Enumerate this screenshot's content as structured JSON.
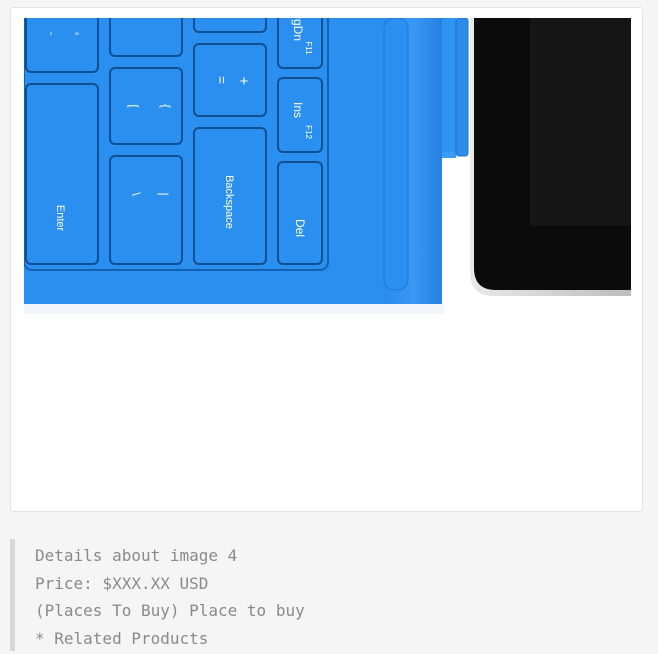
{
  "image": {
    "alt": "",
    "keys": {
      "enter": "Enter",
      "backspace": "Backspace",
      "del": "Del",
      "ins": "Ins",
      "ins_fn": "F12",
      "pgdn": "PgDn",
      "pgdn_fn": "F11",
      "equals": "=",
      "plus": "+",
      "bracket_open": "[",
      "brace_open": "{",
      "backslash": "\\",
      "pipe": "|",
      "comma": "'",
      "quote": "\""
    },
    "colors": {
      "keyboard_blue": "#2b8ff0",
      "key_outline": "#0f4f92",
      "tablet_black": "#0b0b0b"
    }
  },
  "details": {
    "line1": "Details about image 4",
    "line2": "Price: $XXX.XX USD",
    "line3": "(Places To Buy) Place to buy",
    "line4": "* Related Products"
  }
}
